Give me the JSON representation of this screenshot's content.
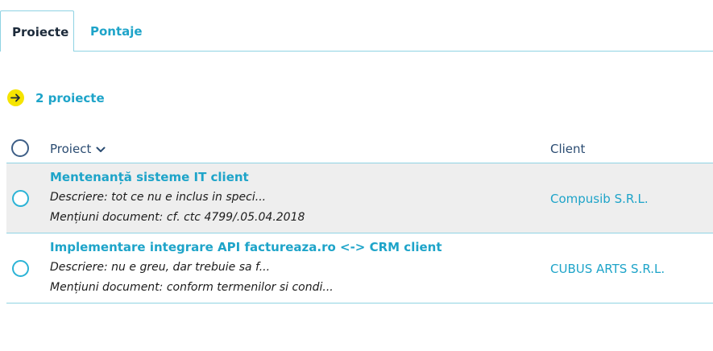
{
  "tabs": [
    {
      "label": "Proiecte",
      "active": true
    },
    {
      "label": "Pontaje",
      "active": false
    }
  ],
  "summary": {
    "icon": "arrow-right-icon",
    "text": "2 proiecte"
  },
  "table": {
    "headers": {
      "project": "Proiect",
      "client": "Client"
    },
    "rows": [
      {
        "title": "Mentenanță sisteme IT client",
        "description": "Descriere: tot ce nu e inclus in speci...",
        "mentions": "Mențiuni document: cf. ctc 4799/.05.04.2018",
        "client": "Compusib S.R.L.",
        "highlighted": true
      },
      {
        "title": "Implementare integrare API factureaza.ro <-> CRM client",
        "description": "Descriere: nu e greu, dar trebuie sa f...",
        "mentions": "Mențiuni document: conform termenilor si condi...",
        "client": "CUBUS ARTS S.R.L.",
        "highlighted": false
      }
    ]
  },
  "colors": {
    "accent": "#1ea4c9",
    "border": "#8fd3e3",
    "header_text": "#2b4c72",
    "badge": "#f5e400",
    "row_highlight": "#eeeeee"
  }
}
